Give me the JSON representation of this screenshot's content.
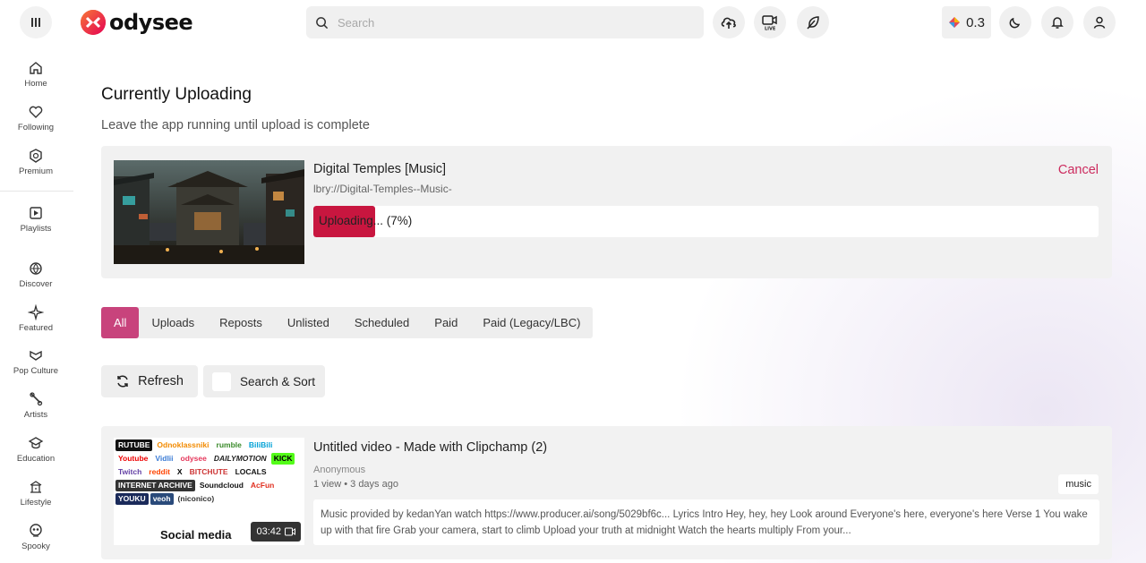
{
  "header": {
    "logo_text": "odysee",
    "search_placeholder": "Search",
    "wallet_balance": "0.3"
  },
  "sidebar": {
    "items": [
      {
        "label": "Home",
        "icon": "home-icon"
      },
      {
        "label": "Following",
        "icon": "heart-icon"
      },
      {
        "label": "Premium",
        "icon": "premium-icon"
      },
      {
        "label": "Playlists",
        "icon": "playlist-icon"
      },
      {
        "label": "Discover",
        "icon": "discover-icon"
      },
      {
        "label": "Featured",
        "icon": "sparkle-icon"
      },
      {
        "label": "Pop Culture",
        "icon": "popculture-icon"
      },
      {
        "label": "Artists",
        "icon": "artists-icon"
      },
      {
        "label": "Education",
        "icon": "education-icon"
      },
      {
        "label": "Lifestyle",
        "icon": "lifestyle-icon"
      },
      {
        "label": "Spooky",
        "icon": "spooky-icon"
      }
    ]
  },
  "page": {
    "title": "Currently Uploading",
    "subtitle": "Leave the app running until upload is complete"
  },
  "upload": {
    "title": "Digital Temples [Music]",
    "url": "lbry://Digital-Temples--Music-",
    "cancel_label": "Cancel",
    "progress_text": "Uploading... (7%)",
    "progress_fraction": 0.07
  },
  "tabs": [
    "All",
    "Uploads",
    "Reposts",
    "Unlisted",
    "Scheduled",
    "Paid",
    "Paid (Legacy/LBC)"
  ],
  "actions": {
    "refresh_label": "Refresh",
    "search_sort_label": "Search & Sort"
  },
  "video": {
    "title": "Untitled video - Made with Clipchamp (2)",
    "author": "Anonymous",
    "meta": "1 view • 3 days ago",
    "tag": "music",
    "duration": "03:42",
    "thumbnail_label": "Social media",
    "thumbnail_platforms": [
      "RUTUBE",
      "Odnoklassniki",
      "rumble",
      "BiliBili",
      "Youtube",
      "Vidlii",
      "odysee",
      "DAILYMOTION",
      "KICK",
      "Twitch",
      "reddit",
      "X",
      "BITCHUTE",
      "LOCALS",
      "INTERNET ARCHIVE",
      "Soundcloud",
      "AcFun",
      "YOUKU",
      "veoh",
      "(niconico)"
    ],
    "description": "Music provided by kedanYan watch https://www.producer.ai/song/5029bf6c... Lyrics Intro Hey, hey, hey Look around Everyone's here, everyone's here Verse 1 You wake up with that fire Grab your camera, start to climb Upload your truth at midnight Watch the hearts multiply From your..."
  },
  "colors": {
    "brand": "#c8437c",
    "progress": "#c8163f",
    "cancel": "#cc2b5e"
  }
}
